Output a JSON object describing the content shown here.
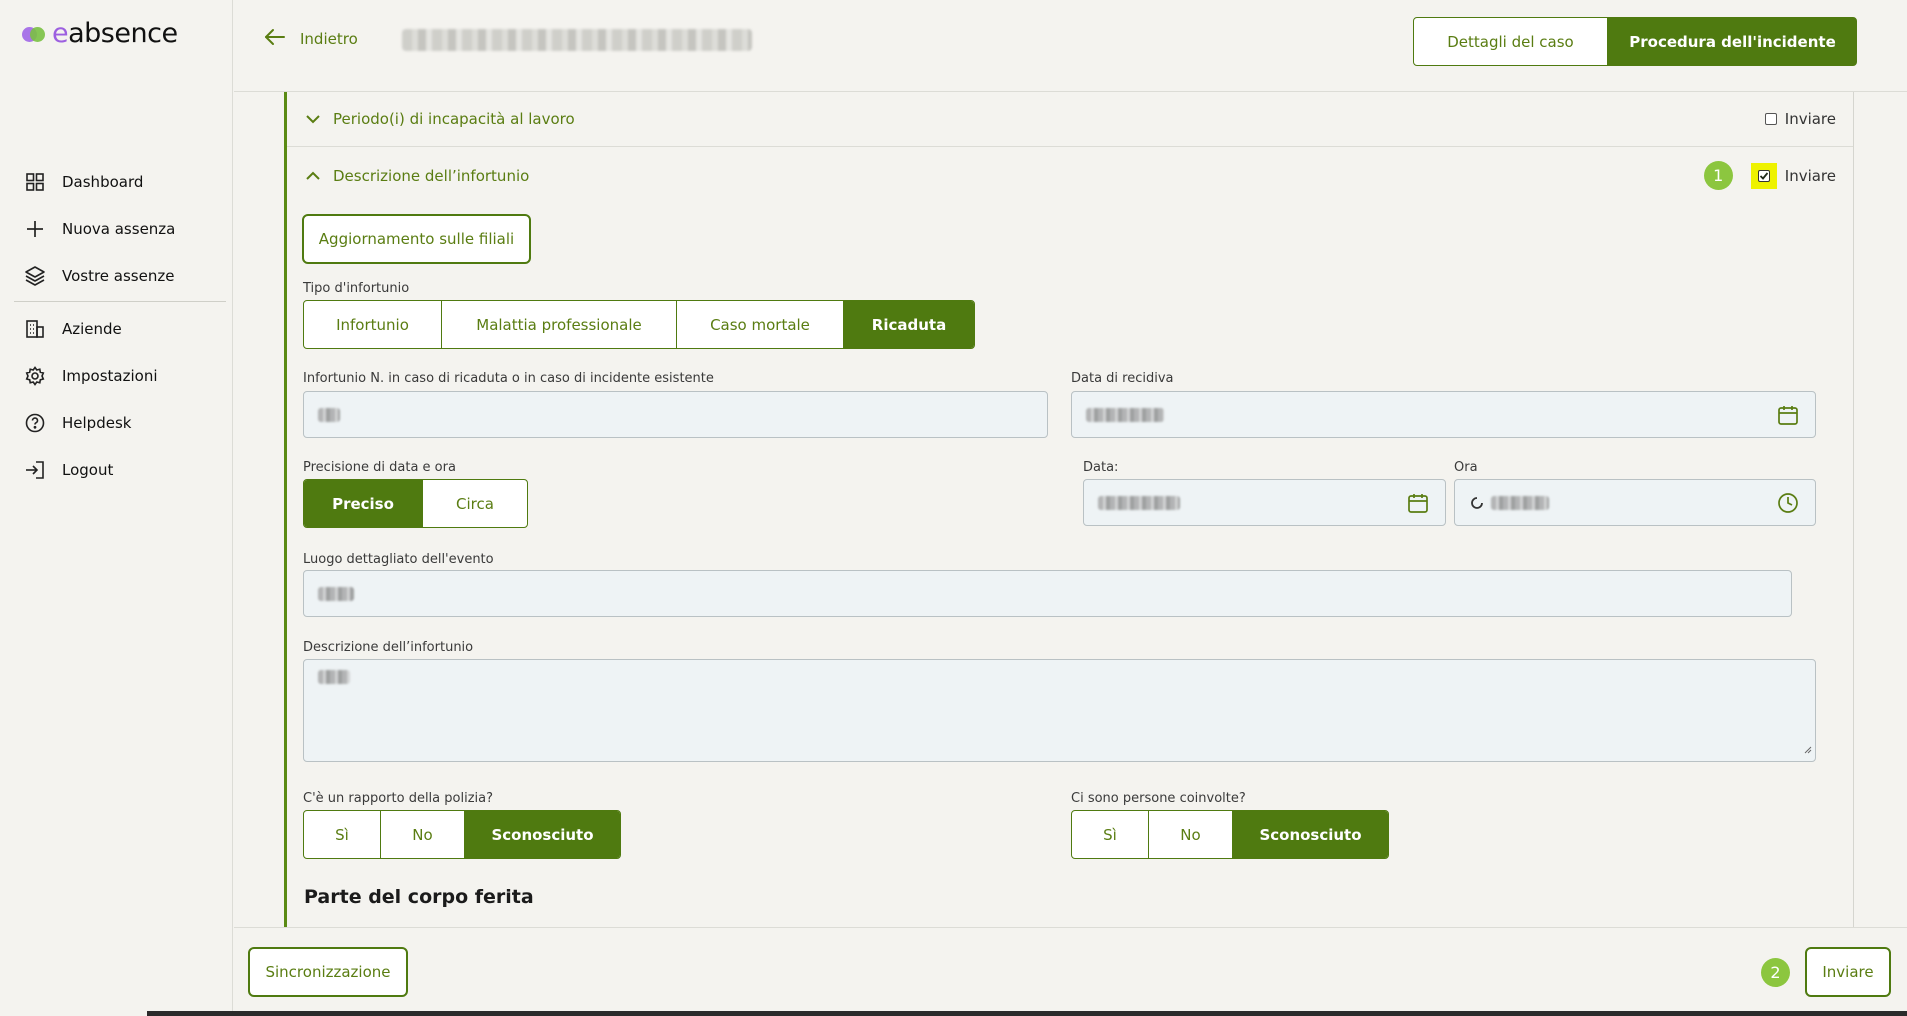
{
  "app": {
    "logo_e": "e",
    "logo_rest": "absence"
  },
  "sidebar": {
    "items": [
      {
        "label": "Dashboard",
        "icon": "grid-icon"
      },
      {
        "label": "Nuova assenza",
        "icon": "plus-icon"
      },
      {
        "label": "Vostre assenze",
        "icon": "layers-icon"
      },
      {
        "label": "Aziende",
        "icon": "building-icon"
      },
      {
        "label": "Impostazioni",
        "icon": "gear-icon"
      },
      {
        "label": "Helpdesk",
        "icon": "help-icon"
      },
      {
        "label": "Logout",
        "icon": "logout-icon"
      }
    ]
  },
  "header": {
    "back_label": "Indietro",
    "tab_details": "Dettagli del caso",
    "tab_procedure": "Procedura dell'incidente"
  },
  "sections": {
    "incapacity": {
      "title": "Periodo(i) di incapacità al lavoro",
      "send_label": "Inviare",
      "checked": false
    },
    "description": {
      "title": "Descrizione dell’infortunio",
      "send_label": "Inviare",
      "checked": true,
      "badge": "1"
    }
  },
  "form": {
    "update_branches_button": "Aggiornamento sulle filiali",
    "accident_type": {
      "label": "Tipo d'infortunio",
      "options": [
        "Infortunio",
        "Malattia professionale",
        "Caso mortale",
        "Ricaduta"
      ],
      "selected": "Ricaduta"
    },
    "accident_number_label": "Infortunio N. in caso di ricaduta o in caso di incidente esistente",
    "relapse_date_label": "Data di recidiva",
    "precision": {
      "label": "Precisione di data e ora",
      "options": [
        "Preciso",
        "Circa"
      ],
      "selected": "Preciso"
    },
    "date_label": "Data:",
    "time_label": "Ora",
    "location_label": "Luogo dettagliato dell'evento",
    "description_label": "Descrizione dell’infortunio",
    "police_report": {
      "label": "C'è un rapporto della polizia?",
      "options": [
        "Sì",
        "No",
        "Sconosciuto"
      ],
      "selected": "Sconosciuto"
    },
    "persons_involved": {
      "label": "Ci sono persone coinvolte?",
      "options": [
        "Sì",
        "No",
        "Sconosciuto"
      ],
      "selected": "Sconosciuto"
    },
    "body_part_heading": "Parte del corpo ferita"
  },
  "footer": {
    "sync_button": "Sincronizzazione",
    "send_button": "Inviare",
    "badge": "2"
  },
  "colors": {
    "primary": "#4f7a10",
    "accent_text": "#5a7d12",
    "badge": "#8cc63f",
    "highlight": "#eef200",
    "background": "#f4f3ef"
  }
}
